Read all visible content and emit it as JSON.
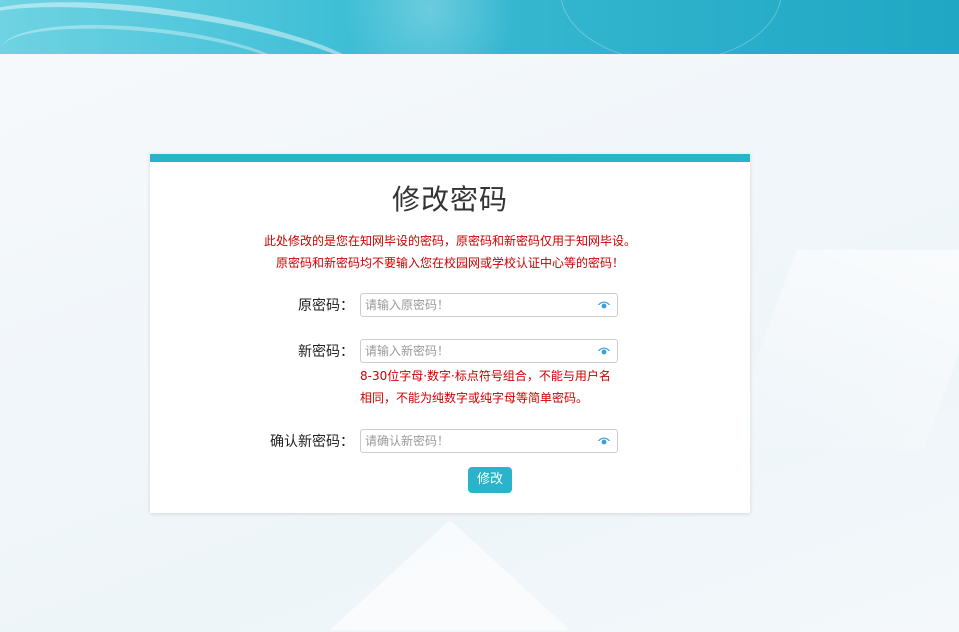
{
  "form": {
    "title": "修改密码",
    "notice_lines": [
      "此处修改的是您在知网毕设的密码，原密码和新密码仅用于知网毕设。",
      "原密码和新密码均不要输入您在校园网或学校认证中心等的密码！"
    ],
    "fields": [
      {
        "label": "原密码：",
        "placeholder": "请输入原密码！",
        "value": ""
      },
      {
        "label": "新密码：",
        "placeholder": "请输入新密码！",
        "value": ""
      },
      {
        "label": "确认新密码：",
        "placeholder": "请确认新密码！",
        "value": ""
      }
    ],
    "new_password_hint": "8-30位字母·数字·标点符号组合，不能与用户名相同，不能为纯数字或纯字母等简单密码。",
    "submit_label": "修改"
  },
  "icons": {
    "reveal": "eye-icon"
  },
  "colors": {
    "accent": "#2ab4cb",
    "warning_text": "#cc0000",
    "eye_icon": "#3a9fd8"
  }
}
